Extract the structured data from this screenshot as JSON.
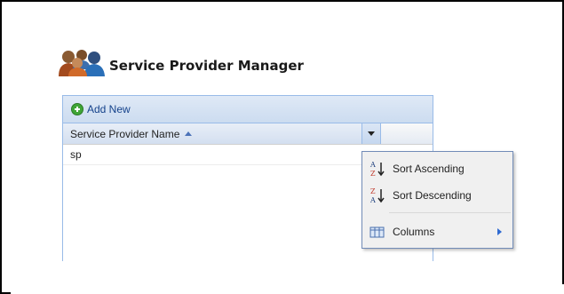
{
  "page": {
    "title": "Service Provider Manager",
    "icon": "users-group-icon"
  },
  "toolbar": {
    "add_label": "Add New",
    "add_icon": "add-circle-icon"
  },
  "grid": {
    "columns": [
      {
        "label": "Service Provider Name",
        "sort": "ascending"
      }
    ],
    "rows": [
      {
        "name": "sp"
      }
    ]
  },
  "column_menu": {
    "items": [
      {
        "label": "Sort Ascending",
        "icon": "sort-ascending-icon"
      },
      {
        "label": "Sort Descending",
        "icon": "sort-descending-icon"
      },
      {
        "label": "Columns",
        "icon": "columns-icon",
        "has_submenu": true
      }
    ]
  },
  "colors": {
    "grid_border": "#99bbe8",
    "toolbar_text": "#15428b",
    "add_icon": "#3fa536",
    "menu_border": "#718bb7"
  }
}
